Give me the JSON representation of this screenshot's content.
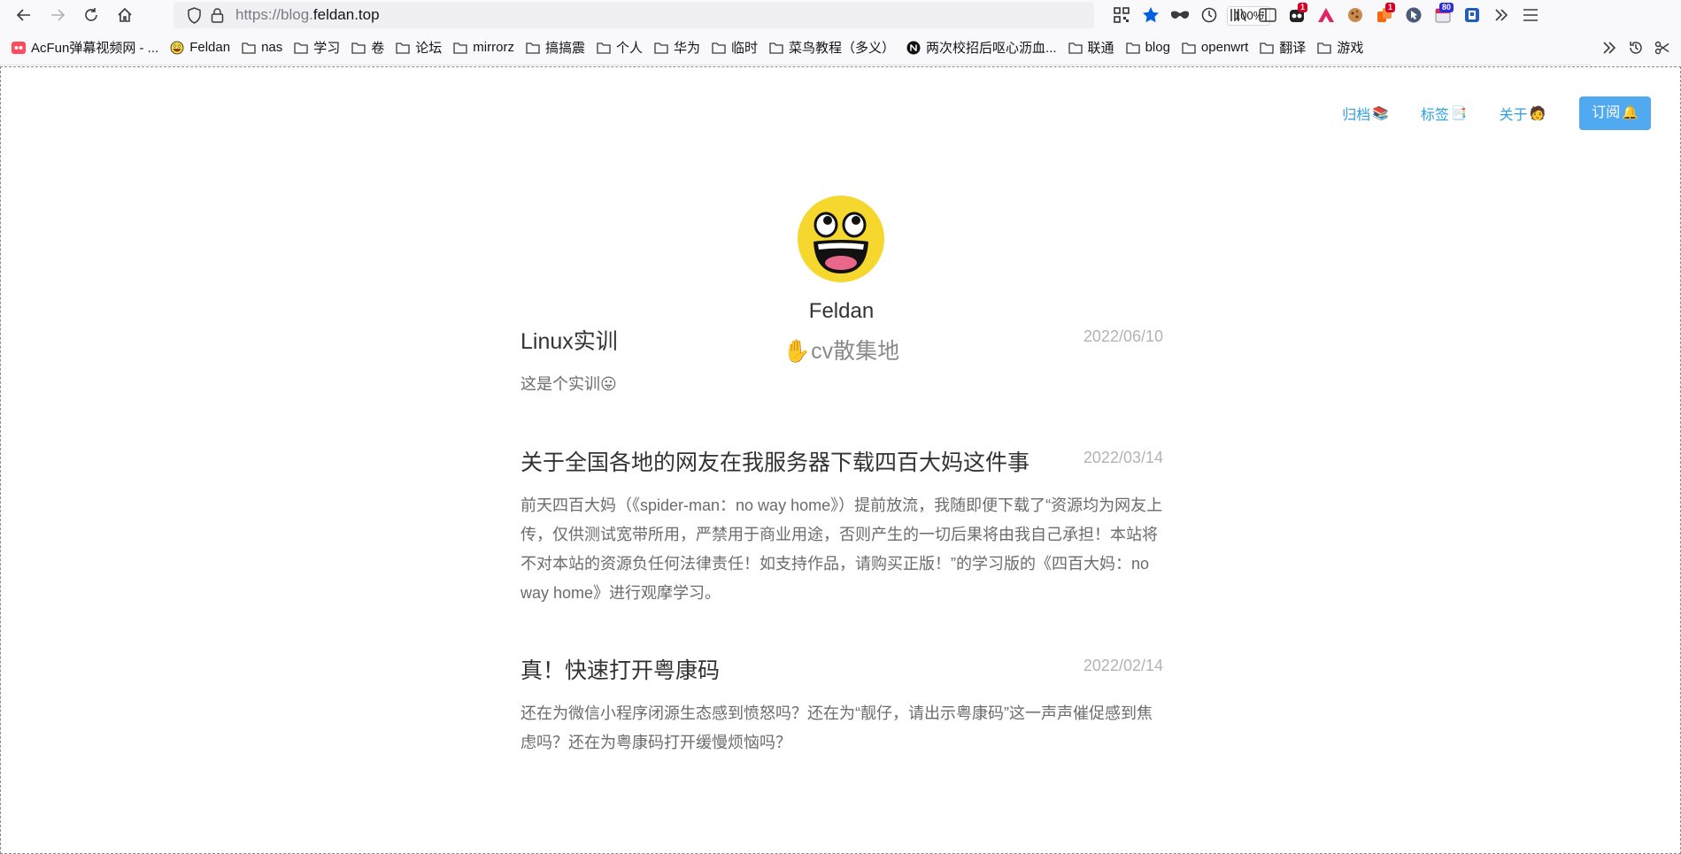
{
  "browser": {
    "url_prefix": "https://blog.",
    "url_domain": "feldan.top",
    "zoom": "100%",
    "badges": {
      "ext1": "1",
      "ext2": "1",
      "ext3": "80"
    }
  },
  "bookmarks": [
    {
      "label": "AcFun弹幕视频网 - ...",
      "icon": "acfun-icon"
    },
    {
      "label": "Feldan",
      "icon": "smiley-icon"
    },
    {
      "label": "nas",
      "icon": "folder-icon"
    },
    {
      "label": "学习",
      "icon": "folder-icon"
    },
    {
      "label": "卷",
      "icon": "folder-icon"
    },
    {
      "label": "论坛",
      "icon": "folder-icon"
    },
    {
      "label": "mirrorz",
      "icon": "folder-icon"
    },
    {
      "label": "搞搞震",
      "icon": "folder-icon"
    },
    {
      "label": "个人",
      "icon": "folder-icon"
    },
    {
      "label": "华为",
      "icon": "folder-icon"
    },
    {
      "label": "临时",
      "icon": "folder-icon"
    },
    {
      "label": "菜鸟教程（多义）",
      "icon": "folder-icon"
    },
    {
      "label": "两次校招后呕心沥血...",
      "icon": "notion-icon"
    },
    {
      "label": "联通",
      "icon": "folder-icon"
    },
    {
      "label": "blog",
      "icon": "folder-icon"
    },
    {
      "label": "openwrt",
      "icon": "folder-icon"
    },
    {
      "label": "翻译",
      "icon": "folder-icon"
    },
    {
      "label": "游戏",
      "icon": "folder-icon"
    }
  ],
  "nav": {
    "archive": "归档",
    "archive_emoji": "📚",
    "tags": "标签",
    "tags_emoji": "📑",
    "about": "关于",
    "about_emoji": "🧑",
    "subscribe": "订阅",
    "subscribe_emoji": "🔔"
  },
  "blog": {
    "name": "Feldan",
    "description_emoji": "✋",
    "description": "cv散集地"
  },
  "posts": [
    {
      "title": "Linux实训",
      "date": "2022/06/10",
      "excerpt": "这是个实训😛"
    },
    {
      "title": "关于全国各地的网友在我服务器下载四百大妈这件事",
      "date": "2022/03/14",
      "excerpt": "前天四百大妈（《spider-man：no way home》）提前放流，我随即便下载了“资源均为网友上传，仅供测试宽带所用，严禁用于商业用途，否则产生的一切后果将由我自己承担！本站将不对本站的资源负任何法律责任！如支持作品，请购买正版！”的学习版的《四百大妈：no way home》进行观摩学习。"
    },
    {
      "title": "真！快速打开粤康码",
      "date": "2022/02/14",
      "excerpt": "还在为微信小程序闭源生态感到愤怒吗？还在为“靓仔，请出示粤康码”这一声声催促感到焦虑吗？还在为粤康码打开缓慢烦恼吗？"
    }
  ],
  "colors": {
    "accent": "#2f9fe3",
    "button": "#51a9f0",
    "avatar_face": "#f6d72e"
  }
}
